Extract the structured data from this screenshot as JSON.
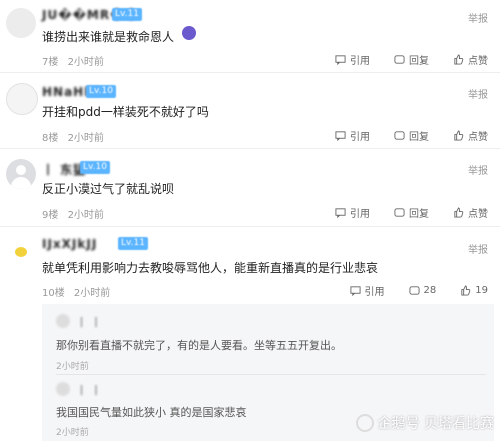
{
  "posts": [
    {
      "username": "JU��MR��",
      "level": "Lv.11",
      "content": "谁捞出来谁就是救命恩人",
      "floor": "7楼",
      "time": "2小时前",
      "report": "举报",
      "quote": "引用",
      "reply": "回复",
      "like": "点赞"
    },
    {
      "username": "HNaHlll",
      "level": "Lv.10",
      "content": "开挂和pdd一样装死不就好了吗",
      "floor": "8楼",
      "time": "2小时前",
      "report": "举报",
      "quote": "引用",
      "reply": "回复",
      "like": "点赞"
    },
    {
      "username": "丨 东猛",
      "level": "Lv.10",
      "content": "反正小漠过气了就乱说呗",
      "floor": "9楼",
      "time": "2小时前",
      "report": "举报",
      "quote": "引用",
      "reply": "回复",
      "like": "点赞"
    },
    {
      "username": "IJxXJkJJ",
      "level": "Lv.11",
      "content": "就单凭利用影响力去教唆辱骂他人，能重新直播真的是行业悲哀",
      "floor": "10楼",
      "time": "2小时前",
      "report": "举报",
      "quote": "引用",
      "reply_count": "28",
      "like_count": "19"
    }
  ],
  "replies": [
    {
      "username": "丨 丨",
      "content": "那你别看直播不就完了，有的是人要看。坐等五五开复出。",
      "time": "2小时前"
    },
    {
      "username": "丨 丨",
      "content": "我国国民气量如此狭小 真的是国家悲哀",
      "time": "2小时前"
    }
  ],
  "watermark": "企鹅号 贝塔看比赛"
}
